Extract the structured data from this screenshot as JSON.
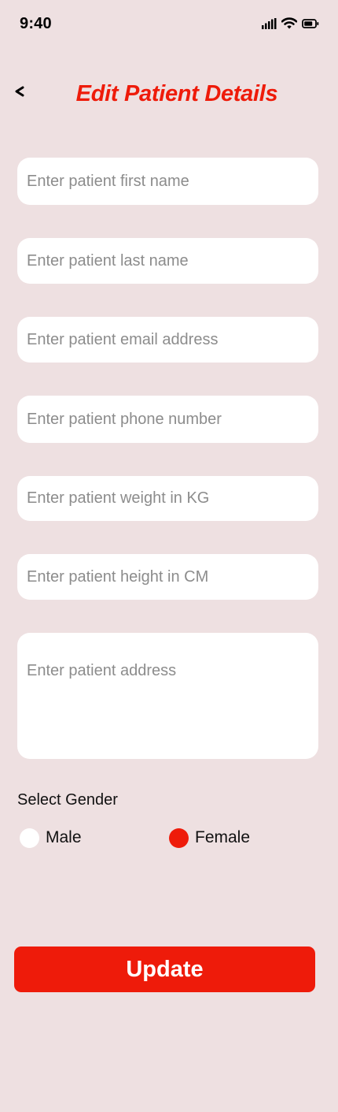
{
  "status_bar": {
    "time": "9:40",
    "icons": [
      "cellular-signal-icon",
      "wifi-icon",
      "battery-icon"
    ]
  },
  "header": {
    "back_icon": "chevron-left-icon",
    "title": "Edit Patient Details"
  },
  "form": {
    "first_name": {
      "placeholder": "Enter patient first name",
      "value": ""
    },
    "last_name": {
      "placeholder": "Enter patient last name",
      "value": ""
    },
    "email": {
      "placeholder": "Enter patient email address",
      "value": ""
    },
    "phone": {
      "placeholder": "Enter patient phone number",
      "value": ""
    },
    "weight": {
      "placeholder": "Enter patient weight in KG",
      "value": ""
    },
    "height": {
      "placeholder": "Enter patient height in CM",
      "value": ""
    },
    "address": {
      "placeholder": "Enter patient address",
      "value": ""
    }
  },
  "gender": {
    "label": "Select Gender",
    "options": [
      {
        "label": "Male",
        "selected": false
      },
      {
        "label": "Female",
        "selected": true
      }
    ]
  },
  "actions": {
    "update_label": "Update"
  },
  "colors": {
    "background": "#EEE0E1",
    "accent": "#EE1B0A",
    "field_background": "#FFFFFF",
    "placeholder_text": "#8C8C8C",
    "radio_unselected": "#FFFFFF"
  }
}
